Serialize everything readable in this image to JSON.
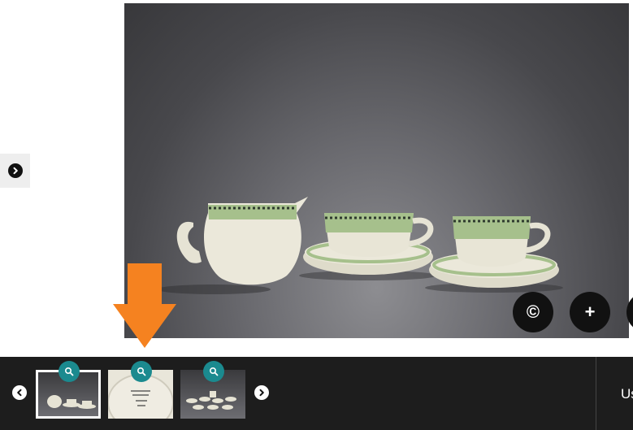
{
  "image_viewer": {
    "main_image_alt": "",
    "side_panel_toggle_icon": "chevron-right-icon",
    "actions": [
      {
        "name": "copyright-button",
        "label": "©"
      },
      {
        "name": "add-button",
        "label": "+"
      }
    ]
  },
  "annotation": {
    "arrow_color": "#f58220"
  },
  "filmstrip": {
    "prev_icon": "chevron-left-icon",
    "next_icon": "chevron-right-icon",
    "thumbnails": [
      {
        "name": "thumbnail-1",
        "active": true
      },
      {
        "name": "thumbnail-2",
        "active": false
      },
      {
        "name": "thumbnail-3",
        "active": false
      }
    ],
    "zoom_badge_color": "#1b8a8f",
    "usage_label": "Us"
  }
}
